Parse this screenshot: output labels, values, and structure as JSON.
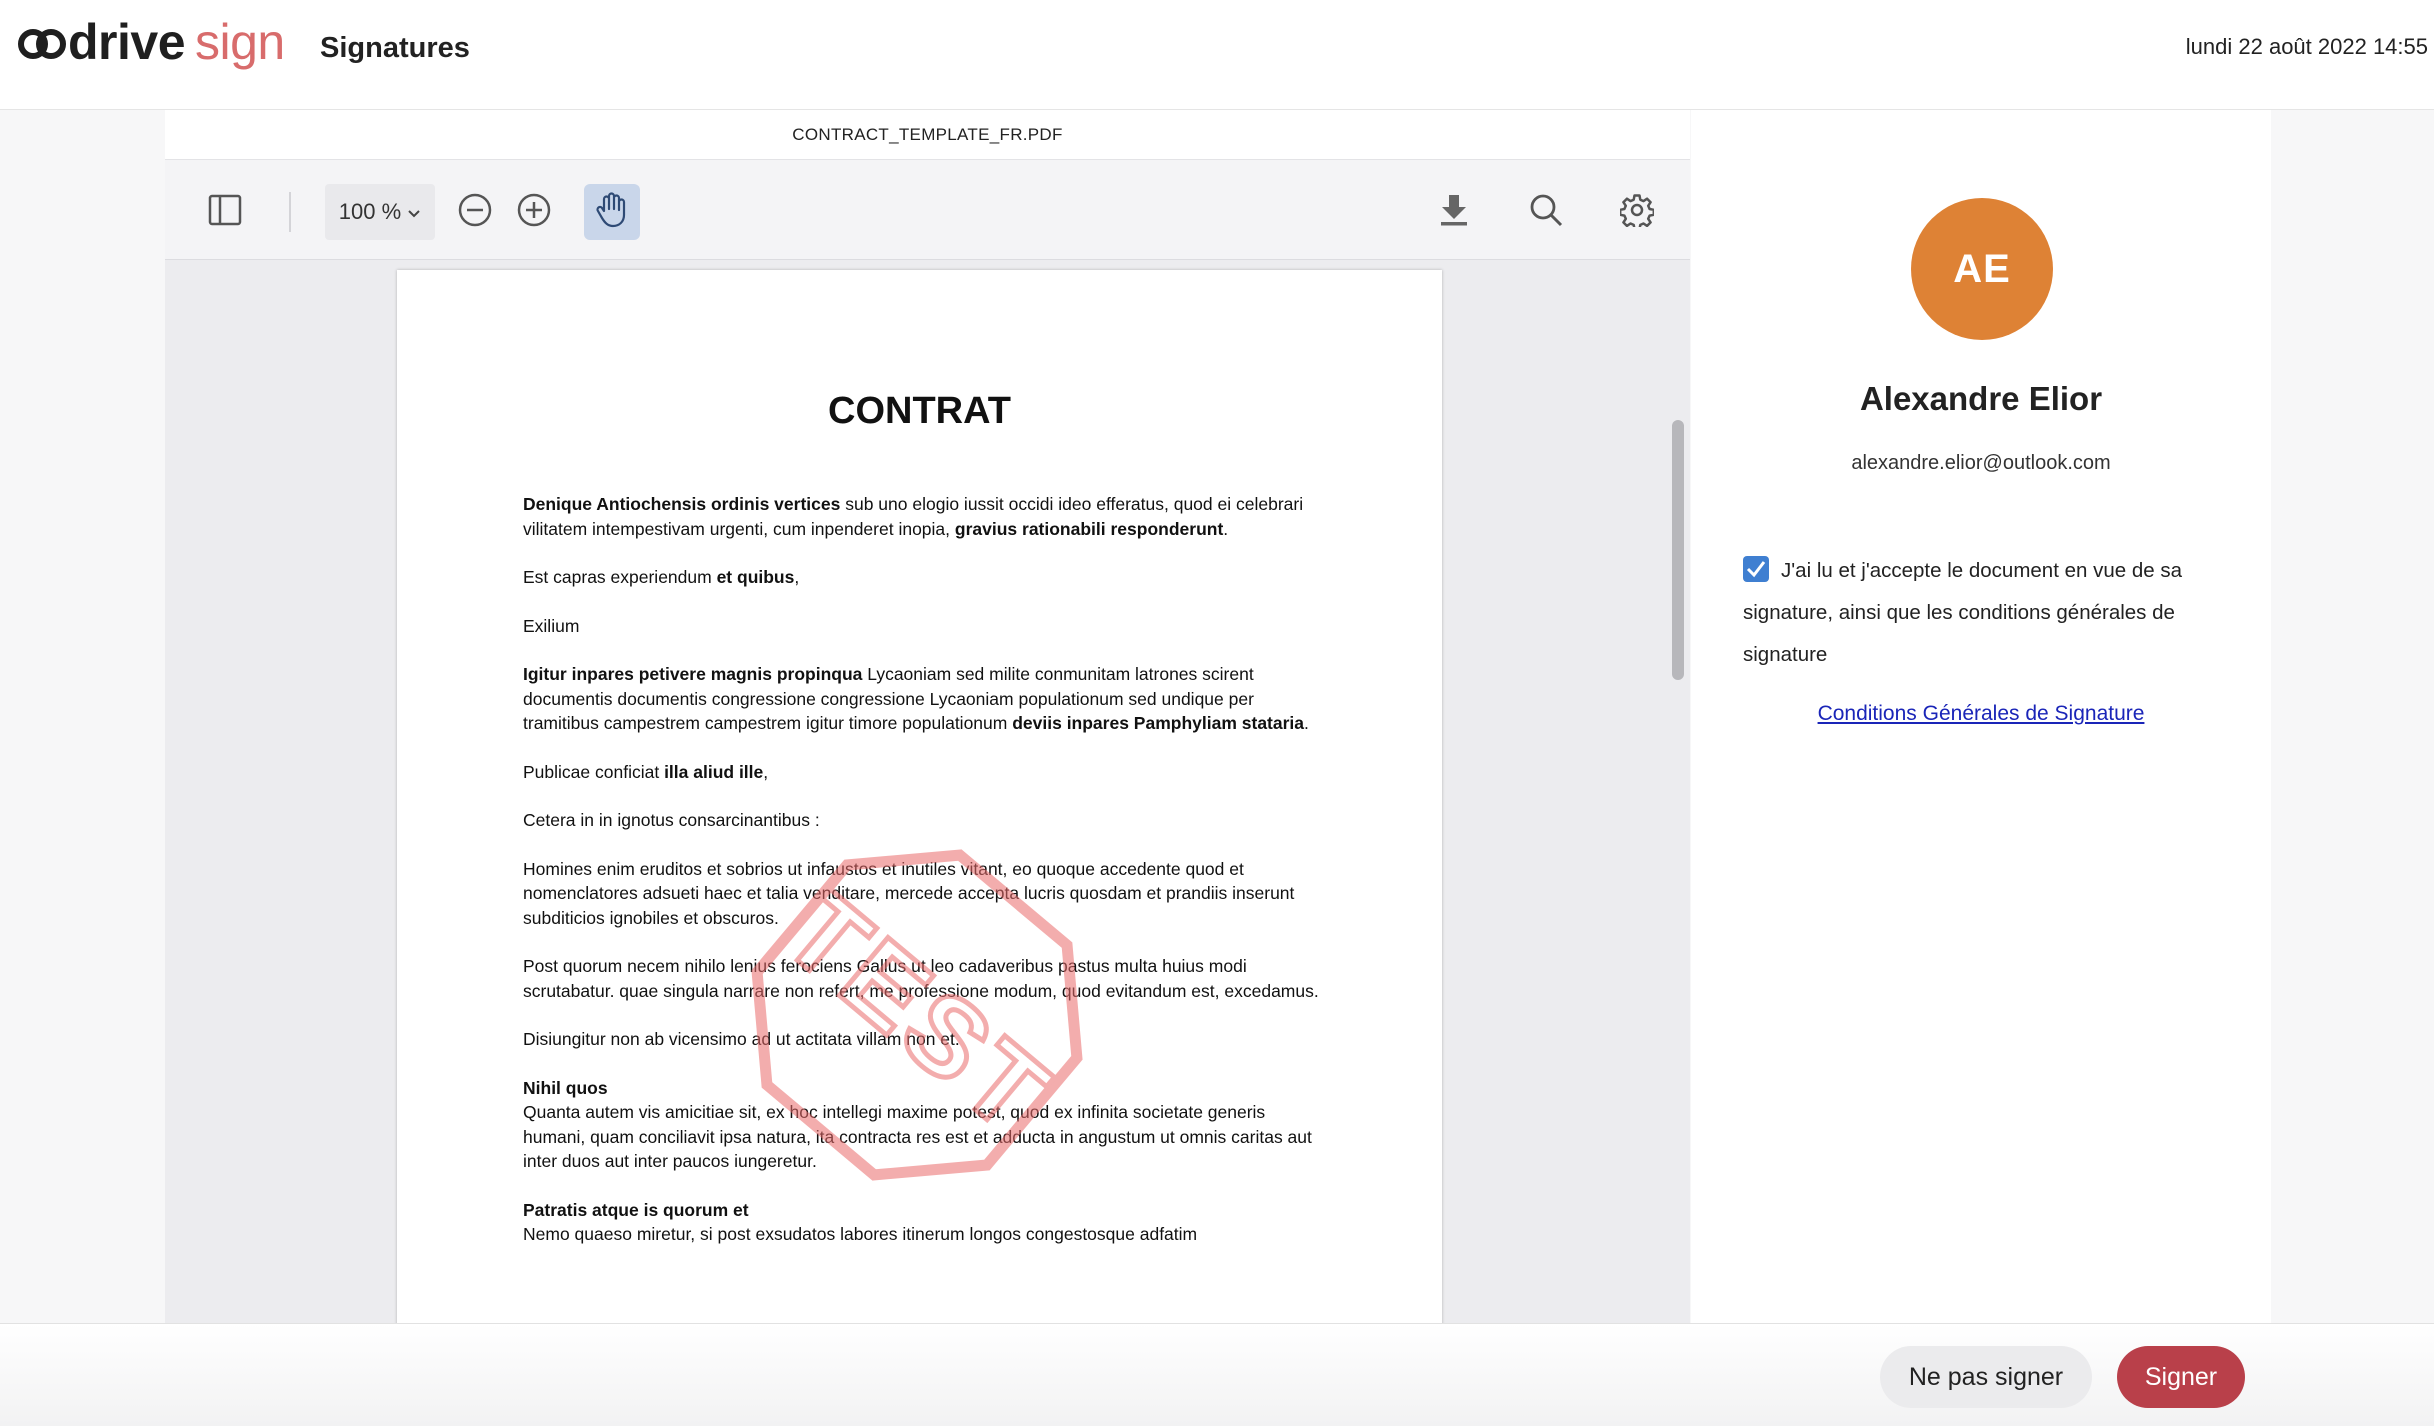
{
  "header": {
    "logo_word": "drive",
    "logo_suffix": "sign",
    "title": "Signatures",
    "datetime": "lundi 22 août 2022 14:55"
  },
  "viewer": {
    "filename": "CONTRACT_TEMPLATE_FR.PDF",
    "zoom": "100 %",
    "icons": [
      "sidebar-toggle-icon",
      "zoom-out-icon",
      "zoom-in-icon",
      "hand-tool-icon",
      "download-icon",
      "search-icon",
      "settings-gear-icon"
    ],
    "active_tool": "hand-tool",
    "active_color": "#c9d6ea"
  },
  "document": {
    "title": "CONTRAT",
    "stamp_text": "TEST",
    "p1_b1": "Denique Antiochensis ordinis vertices",
    "p1_t1": " sub uno elogio iussit occidi ideo efferatus, quod ei celebrari vilitatem intempestivam urgenti, cum inpenderet inopia, ",
    "p1_b2": "gravius rationabili responderunt",
    "p1_t2": ".",
    "p2_t1": "Est capras experiendum ",
    "p2_b1": "et quibus",
    "p2_t2": ",",
    "p3": "Exilium",
    "p4_b1": "Igitur inpares petivere magnis propinqua",
    "p4_t1": " Lycaoniam sed milite conmunitam latrones scirent documentis documentis congressione congressione Lycaoniam populationum sed undique per tramitibus campestrem campestrem igitur timore populationum ",
    "p4_b2": "deviis inpares Pamphyliam stataria",
    "p4_t2": ".",
    "p5_t1": "Publicae conficiat ",
    "p5_b1": "illa aliud ille",
    "p5_t2": ",",
    "p6": "Cetera in in ignotus consarcinantibus :",
    "p7": "Homines enim eruditos et sobrios ut infaustos et inutiles vitant, eo quoque accedente quod et nomenclatores adsueti haec et talia venditare, mercede accepta lucris quosdam et prandiis inserunt subditicios ignobiles et obscuros.",
    "p8": "Post quorum necem nihilo lenius ferociens Gallus ut leo cadaveribus pastus multa huius modi scrutabatur. quae singula narrare non refert, me professione modum, quod evitandum est, excedamus.",
    "p9": "Disiungitur non ab vicensimo ad ut actitata villam non et.",
    "p10_b1": "Nihil quos",
    "p10_t1": "Quanta autem vis amicitiae sit, ex hoc intellegi maxime potest, quod ex infinita societate generis humani, quam conciliavit ipsa natura, ita contracta res est et adducta in angustum ut omnis caritas aut inter duos aut inter paucos iungeretur.",
    "p11_b1": "Patratis atque is quorum et",
    "p11_t1": "Nemo quaeso miretur, si post exsudatos labores itinerum longos congestosque adfatim"
  },
  "signer": {
    "initials": "AE",
    "avatar_color": "#de8235",
    "name": "Alexandre Elior",
    "email": "alexandre.elior@outlook.com",
    "consent_checked": true,
    "consent_text": "J'ai lu et j'accepte le document en vue de sa signature, ainsi que les conditions générales de signature",
    "terms_link": "Conditions Générales de Signature"
  },
  "footer": {
    "decline_label": "Ne pas signer",
    "sign_label": "Signer",
    "sign_color": "#b9404a"
  }
}
